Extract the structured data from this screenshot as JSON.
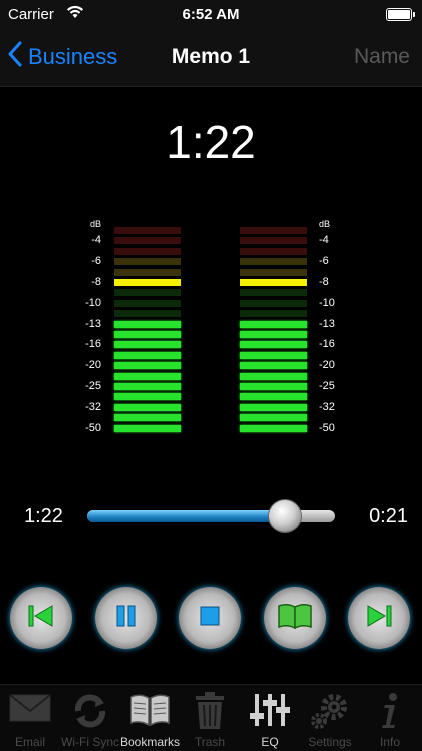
{
  "status": {
    "carrier": "Carrier",
    "time": "6:52 AM"
  },
  "nav": {
    "back_label": "Business",
    "title": "Memo 1",
    "right_label": "Name"
  },
  "timer": "1:22",
  "meter": {
    "scale_labels": [
      "dB",
      "-4",
      "-6",
      "-8",
      "-10",
      "-13",
      "-16",
      "-20",
      "-25",
      "-32",
      "-50"
    ],
    "left_level_segments_lit": 11,
    "right_level_segments_lit": 11,
    "peak_marker_db": "-8",
    "colors": {
      "red_dim": "#3a0d0d",
      "yellow_dim": "#3a330a",
      "yellow_peak": "#f5f000",
      "green_dim": "#0a2a0a",
      "green": "#27e32b"
    }
  },
  "playback": {
    "elapsed": "1:22",
    "remaining": "0:21",
    "progress_fraction": 0.8
  },
  "controls": [
    {
      "name": "previous-button",
      "icon": "skip-back-icon"
    },
    {
      "name": "pause-button",
      "icon": "pause-icon"
    },
    {
      "name": "stop-button",
      "icon": "stop-icon"
    },
    {
      "name": "bookmark-book-button",
      "icon": "book-icon"
    },
    {
      "name": "next-button",
      "icon": "skip-forward-icon"
    }
  ],
  "tabs": [
    {
      "label": "Email",
      "icon": "envelope-icon",
      "active": false
    },
    {
      "label": "Wi-Fi Sync",
      "icon": "sync-icon",
      "active": false
    },
    {
      "label": "Bookmarks",
      "icon": "book-icon",
      "active": true
    },
    {
      "label": "Trash",
      "icon": "trash-icon",
      "active": false
    },
    {
      "label": "EQ",
      "icon": "equalizer-icon",
      "active": true
    },
    {
      "label": "Settings",
      "icon": "gear-icon",
      "active": false
    },
    {
      "label": "Info",
      "icon": "info-icon",
      "active": false
    }
  ],
  "accent_color": "#1a84ff"
}
